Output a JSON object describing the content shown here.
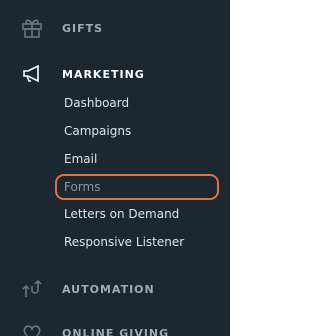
{
  "sidebar": {
    "sections": [
      {
        "label": "GIFTS",
        "icon": "gift-icon"
      },
      {
        "label": "MARKETING",
        "icon": "megaphone-icon",
        "expanded": true,
        "items": [
          {
            "label": "Dashboard"
          },
          {
            "label": "Campaigns"
          },
          {
            "label": "Email"
          },
          {
            "label": "Forms",
            "highlighted": true
          },
          {
            "label": "Letters on Demand"
          },
          {
            "label": "Responsive Listener"
          }
        ]
      },
      {
        "label": "AUTOMATION",
        "icon": "automation-icon"
      },
      {
        "label": "ONLINE GIVING",
        "icon": "handshake-icon"
      }
    ]
  },
  "colors": {
    "sidebar_bg": "#1d2730",
    "highlight_border": "#e0714a",
    "section_label": "#a3abb2",
    "active_section_label": "#ffffff"
  }
}
